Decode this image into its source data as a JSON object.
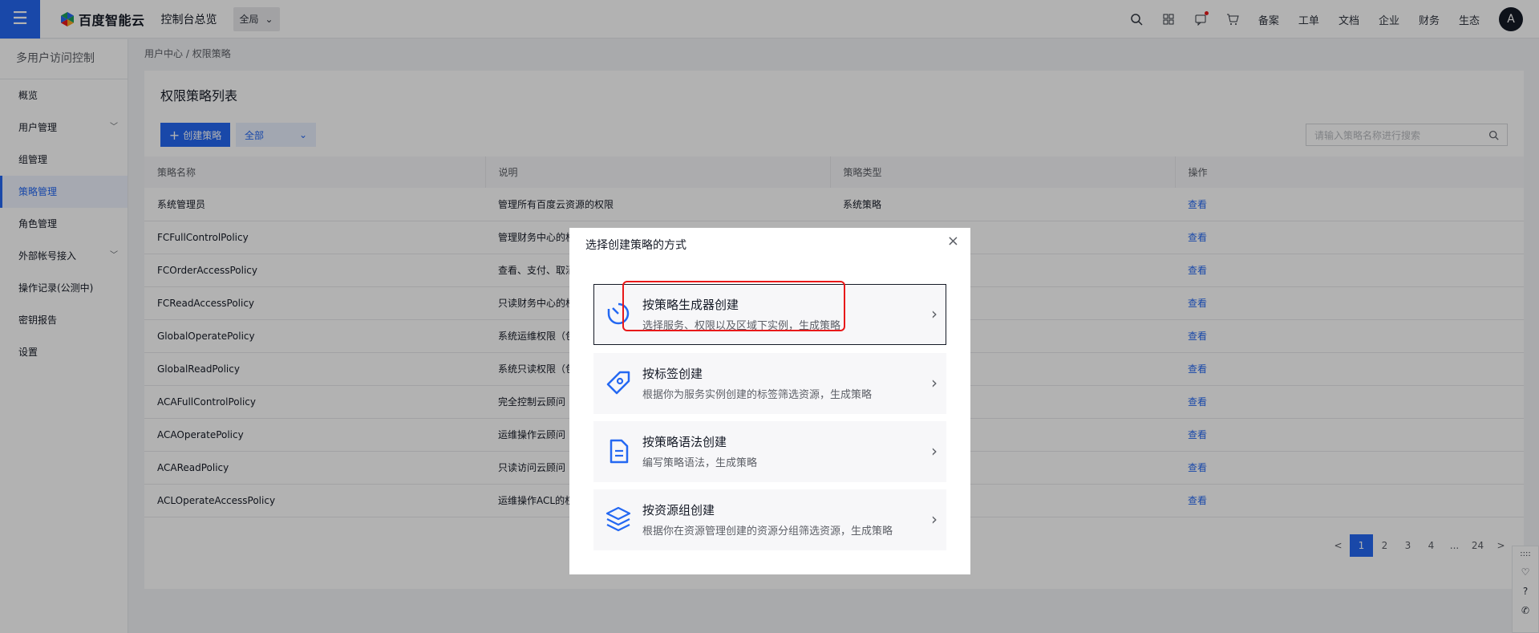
{
  "topbar": {
    "logo_text": "百度智能云",
    "console_title": "控制台总览",
    "region": "全局",
    "links": [
      "备案",
      "工单",
      "文档",
      "企业",
      "财务",
      "生态"
    ],
    "avatar_letter": "A"
  },
  "sidebar": {
    "title": "多用户访问控制",
    "items": [
      {
        "label": "概览"
      },
      {
        "label": "用户管理"
      },
      {
        "label": "组管理"
      },
      {
        "label": "策略管理"
      },
      {
        "label": "角色管理"
      },
      {
        "label": "外部帐号接入"
      },
      {
        "label": "操作记录(公测中)"
      },
      {
        "label": "密钥报告"
      },
      {
        "label": "设置"
      }
    ]
  },
  "breadcrumb": {
    "parent": "用户中心",
    "current": "权限策略"
  },
  "main": {
    "title": "权限策略列表",
    "create_label": "创建策略",
    "filter_value": "全部",
    "search_placeholder": "请输入策略名称进行搜索",
    "columns": [
      "策略名称",
      "说明",
      "策略类型",
      "操作"
    ],
    "rows": [
      {
        "name": "系统管理员",
        "desc": "管理所有百度云资源的权限",
        "type": "系统策略",
        "action": "查看"
      },
      {
        "name": "FCFullControlPolicy",
        "desc": "管理财务中心的权",
        "type": "",
        "action": "查看"
      },
      {
        "name": "FCOrderAccessPolicy",
        "desc": "查看、支付、取消",
        "type": "",
        "action": "查看"
      },
      {
        "name": "FCReadAccessPolicy",
        "desc": "只读财务中心的权",
        "type": "",
        "action": "查看"
      },
      {
        "name": "GlobalOperatePolicy",
        "desc": "系统运维权限（包",
        "type": "",
        "action": "查看"
      },
      {
        "name": "GlobalReadPolicy",
        "desc": "系统只读权限（包",
        "type": "",
        "action": "查看"
      },
      {
        "name": "ACAFullControlPolicy",
        "desc": "完全控制云顾问",
        "type": "",
        "action": "查看"
      },
      {
        "name": "ACAOperatePolicy",
        "desc": "运维操作云顾问",
        "type": "",
        "action": "查看"
      },
      {
        "name": "ACAReadPolicy",
        "desc": "只读访问云顾问",
        "type": "",
        "action": "查看"
      },
      {
        "name": "ACLOperateAccessPolicy",
        "desc": "运维操作ACL的权",
        "type": "",
        "action": "查看"
      }
    ],
    "pager": {
      "prev": "<",
      "pages": [
        "1",
        "2",
        "3",
        "4"
      ],
      "ellipsis": "...",
      "last": "24",
      "next": ">"
    }
  },
  "float_bar": {
    "top_label": "::::"
  },
  "modal": {
    "title": "选择创建策略的方式",
    "close": "×",
    "options": [
      {
        "title": "按策略生成器创建",
        "desc": "选择服务、权限以及区域下实例，生成策略"
      },
      {
        "title": "按标签创建",
        "desc": "根据你为服务实例创建的标签筛选资源，生成策略"
      },
      {
        "title": "按策略语法创建",
        "desc": "编写策略语法，生成策略"
      },
      {
        "title": "按资源组创建",
        "desc": "根据你在资源管理创建的资源分组筛选资源，生成策略"
      }
    ]
  },
  "colors": {
    "brand": "#2468f2",
    "highlight": "#e8191a"
  }
}
